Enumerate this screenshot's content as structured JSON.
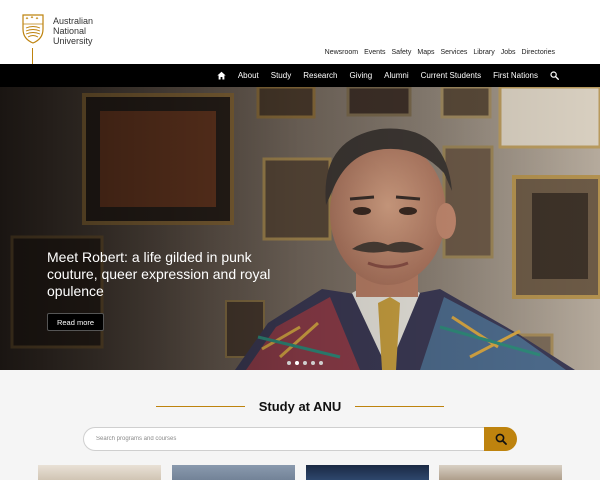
{
  "brand": {
    "line1": "Australian",
    "line2": "National",
    "line3": "University",
    "crest_icon": "anu-crest-icon",
    "gold": "#be830e"
  },
  "utility_nav": [
    "Newsroom",
    "Events",
    "Safety",
    "Maps",
    "Services",
    "Library",
    "Jobs",
    "Directories"
  ],
  "main_nav": {
    "home_icon": "home-icon",
    "items": [
      "About",
      "Study",
      "Research",
      "Giving",
      "Alumni",
      "Current Students",
      "First Nations"
    ],
    "search_icon": "search-icon"
  },
  "hero": {
    "headline": "Meet Robert: a life gilded in punk couture, queer expression and royal opulence",
    "button": "Read more",
    "slide_count": 5,
    "active_slide": 1
  },
  "study": {
    "title": "Study at ANU",
    "search_placeholder": "Search programs and courses",
    "search_button_icon": "search-icon"
  }
}
